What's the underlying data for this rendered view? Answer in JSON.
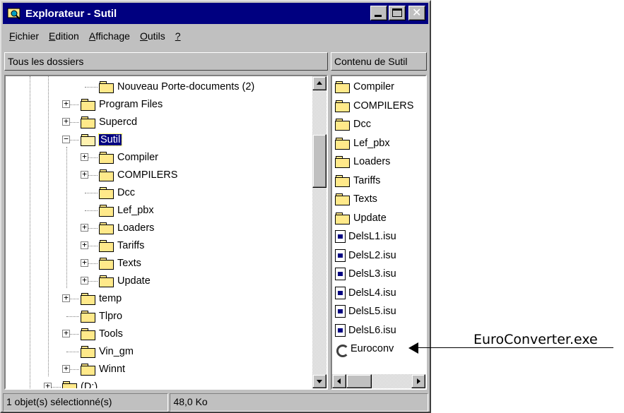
{
  "window": {
    "title": "Explorateur - Sutil",
    "controls": {
      "minimize_icon": "minimize-icon",
      "maximize_icon": "maximize-icon",
      "close_icon": "close-icon"
    }
  },
  "menu": [
    {
      "accel": "F",
      "rest": "ichier"
    },
    {
      "accel": "E",
      "rest": "dition"
    },
    {
      "accel": "A",
      "rest": "ffichage"
    },
    {
      "accel": "O",
      "rest": "utils"
    },
    {
      "accel": "?",
      "rest": ""
    }
  ],
  "left_pane": {
    "header": "Tous les dossiers",
    "items": [
      {
        "label": "Nouveau Porte-documents (2)",
        "expander": ""
      },
      {
        "label": "Program Files",
        "expander": "+"
      },
      {
        "label": "Supercd",
        "expander": "+"
      },
      {
        "label": "Sutil",
        "expander": "−",
        "selected": true
      },
      {
        "label": "Compiler",
        "expander": "+"
      },
      {
        "label": "COMPILERS",
        "expander": "+"
      },
      {
        "label": "Dcc",
        "expander": ""
      },
      {
        "label": "Lef_pbx",
        "expander": ""
      },
      {
        "label": "Loaders",
        "expander": "+"
      },
      {
        "label": "Tariffs",
        "expander": "+"
      },
      {
        "label": "Texts",
        "expander": "+"
      },
      {
        "label": "Update",
        "expander": "+"
      },
      {
        "label": "temp",
        "expander": "+"
      },
      {
        "label": "Tlpro",
        "expander": ""
      },
      {
        "label": "Tools",
        "expander": "+"
      },
      {
        "label": "Vin_gm",
        "expander": ""
      },
      {
        "label": "Winnt",
        "expander": "+"
      },
      {
        "label": "(D:)",
        "expander": "+"
      }
    ]
  },
  "right_pane": {
    "header": "Contenu de Sutil",
    "items": [
      {
        "label": "Compiler",
        "icon": "folder-icon"
      },
      {
        "label": "COMPILERS",
        "icon": "folder-icon"
      },
      {
        "label": "Dcc",
        "icon": "folder-icon"
      },
      {
        "label": "Lef_pbx",
        "icon": "folder-icon"
      },
      {
        "label": "Loaders",
        "icon": "folder-icon"
      },
      {
        "label": "Tariffs",
        "icon": "folder-icon"
      },
      {
        "label": "Texts",
        "icon": "folder-icon"
      },
      {
        "label": "Update",
        "icon": "folder-icon"
      },
      {
        "label": "DelsL1.isu",
        "icon": "file-icon"
      },
      {
        "label": "DelsL2.isu",
        "icon": "file-icon"
      },
      {
        "label": "DelsL3.isu",
        "icon": "file-icon"
      },
      {
        "label": "DelsL4.isu",
        "icon": "file-icon"
      },
      {
        "label": "DelsL5.isu",
        "icon": "file-icon"
      },
      {
        "label": "DelsL6.isu",
        "icon": "file-icon"
      },
      {
        "label": "Euroconv",
        "icon": "exe-icon"
      }
    ]
  },
  "status": {
    "selection": "1 objet(s) sélectionné(s)",
    "size": "48,0 Ko"
  },
  "annotation": {
    "text": "EuroConverter.exe"
  }
}
